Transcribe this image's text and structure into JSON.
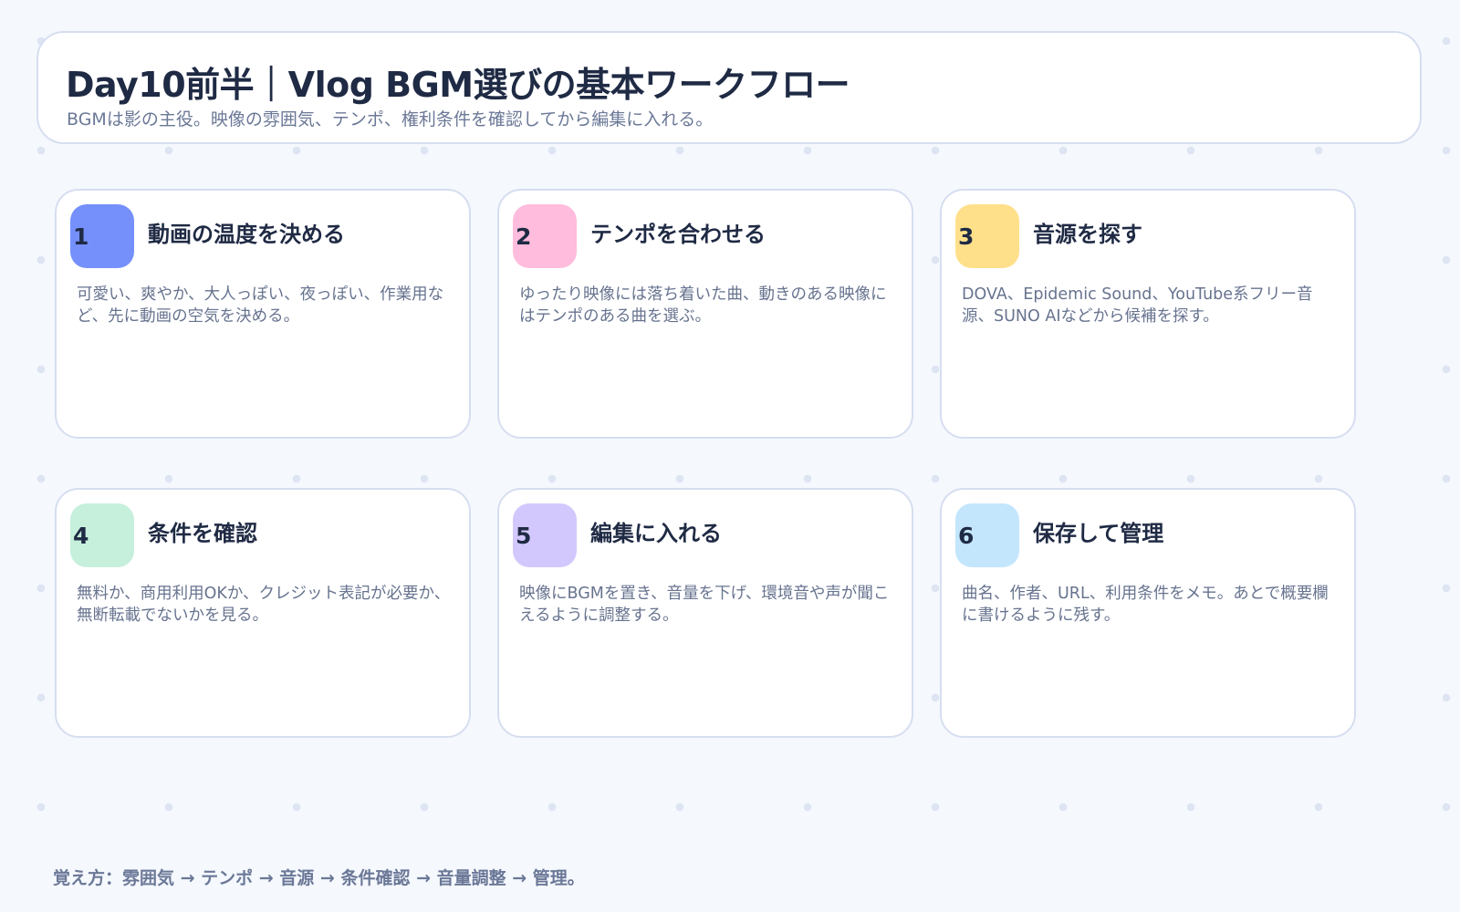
{
  "header": {
    "title": "Day10前半｜Vlog BGM選びの基本ワークフロー",
    "subtitle": "BGMは影の主役。映像の雰囲気、テンポ、権利条件を確認してから編集に入れる。"
  },
  "steps": [
    {
      "number": "1",
      "title": "動画の温度を決める",
      "description": "可愛い、爽やか、大人っぽい、夜っぽい、作業用など、先に動画の空気を決める。",
      "color": "#7590fb"
    },
    {
      "number": "2",
      "title": "テンポを合わせる",
      "description": "ゆったり映像には落ち着いた曲、動きのある映像にはテンポのある曲を選ぶ。",
      "color": "#ffbcdc"
    },
    {
      "number": "3",
      "title": "音源を探す",
      "description": "DOVA、Epidemic Sound、YouTube系フリー音源、SUNO AIなどから候補を探す。",
      "color": "#ffe08a"
    },
    {
      "number": "4",
      "title": "条件を確認",
      "description": "無料か、商用利用OKか、クレジット表記が必要か、無断転載でないかを見る。",
      "color": "#c6efdc"
    },
    {
      "number": "5",
      "title": "編集に入れる",
      "description": "映像にBGMを置き、音量を下げ、環境音や声が聞こえるように調整する。",
      "color": "#d3c8fd"
    },
    {
      "number": "6",
      "title": "保存して管理",
      "description": "曲名、作者、URL、利用条件をメモ。あとで概要欄に書けるように残す。",
      "color": "#c3e6fd"
    }
  ],
  "footer": "覚え方：雰囲気 → テンポ → 音源 → 条件確認 → 音量調整 → 管理。"
}
